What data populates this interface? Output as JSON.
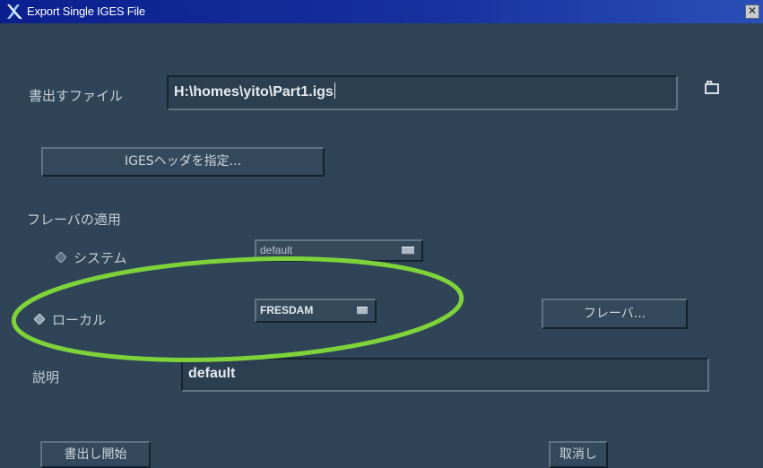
{
  "window": {
    "title": "Export Single IGES File",
    "close_glyph": "✕"
  },
  "file": {
    "label": "書出すファイル",
    "value": "H:\\homes\\yito\\Part1.igs"
  },
  "header_button": {
    "label": "IGESヘッダを指定..."
  },
  "flavor": {
    "group_label": "フレーバの適用",
    "system_label": "システム",
    "system_value": "default",
    "local_label": "ローカル",
    "local_value": "FRESDAM",
    "flavor_button": "フレーバ..."
  },
  "description": {
    "label": "説明",
    "value": "default"
  },
  "actions": {
    "start_label": "書出し開始",
    "cancel_label": "取消し"
  },
  "colors": {
    "background": "#2f4456",
    "titlebar": "#16309e",
    "highlight_ellipse": "#7ed33a"
  },
  "icons": {
    "app": "x-logo-icon",
    "folder": "folder-icon",
    "close": "close-icon",
    "radio": "diamond-radio-icon",
    "dropdown": "option-menu-indicator-icon"
  }
}
